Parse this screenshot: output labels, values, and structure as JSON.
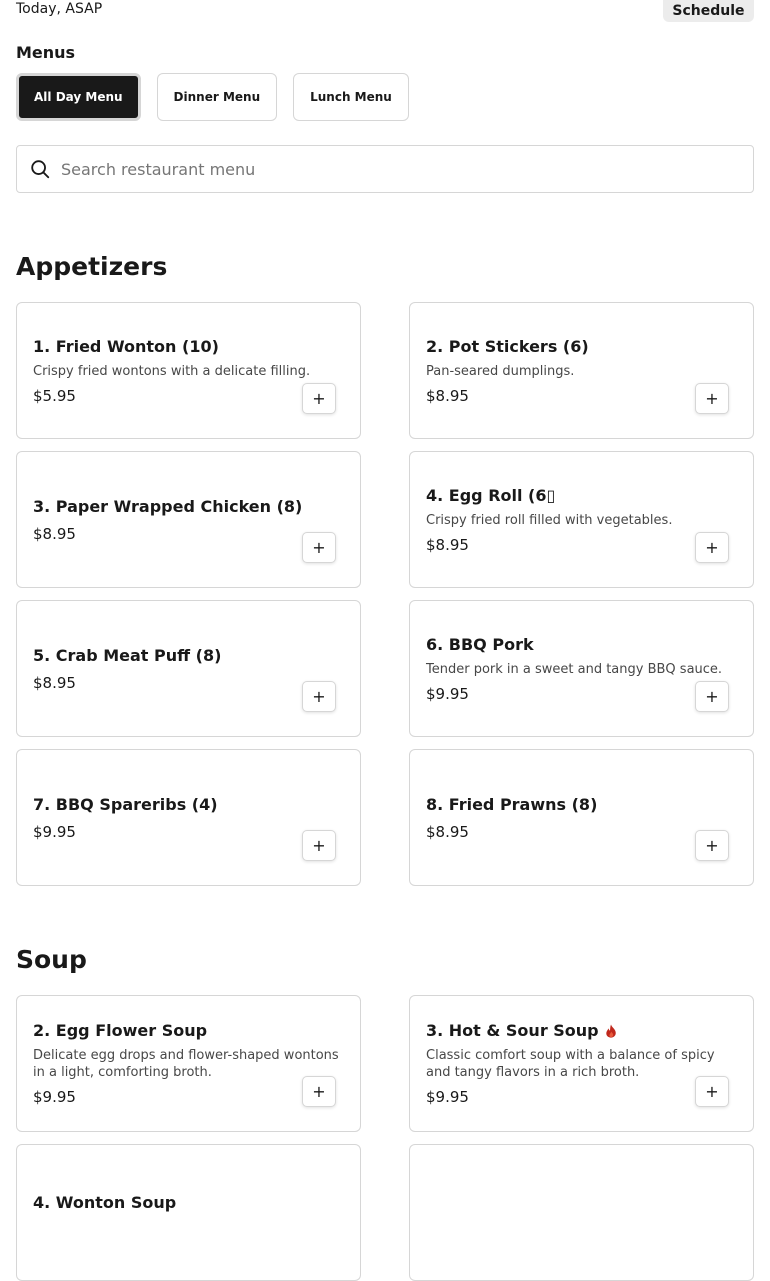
{
  "header": {
    "time_label": "Today, ASAP",
    "schedule_label": "Schedule"
  },
  "menus": {
    "heading": "Menus",
    "tabs": [
      {
        "label": "All Day Menu",
        "active": true
      },
      {
        "label": "Dinner Menu",
        "active": false
      },
      {
        "label": "Lunch Menu",
        "active": false
      }
    ]
  },
  "search": {
    "icon": "search-icon",
    "placeholder": "Search restaurant menu"
  },
  "add_icon": "+",
  "colors": {
    "spicy": "#c0281c"
  },
  "sections": [
    {
      "title": "Appetizers",
      "items": [
        {
          "name": "1. Fried Wonton (10)",
          "description": "Crispy fried wontons with a delicate filling.",
          "price": "$5.95"
        },
        {
          "name": "2. Pot Stickers (6)",
          "description": "Pan-seared dumplings.",
          "price": "$8.95"
        },
        {
          "name": "3. Paper Wrapped Chicken (8)",
          "description": "",
          "price": "$8.95"
        },
        {
          "name": "4. Egg Roll (6▯",
          "description": "Crispy fried roll filled with vegetables.",
          "price": "$8.95"
        },
        {
          "name": "5. Crab Meat Puff (8)",
          "description": "",
          "price": "$8.95"
        },
        {
          "name": "6. BBQ Pork",
          "description": "Tender pork in a sweet and tangy BBQ sauce.",
          "price": "$9.95"
        },
        {
          "name": "7. BBQ Spareribs (4)",
          "description": "",
          "price": "$9.95"
        },
        {
          "name": "8. Fried Prawns (8)",
          "description": "",
          "price": "$8.95"
        }
      ]
    },
    {
      "title": "Soup",
      "items": [
        {
          "name": "2. Egg Flower Soup",
          "description": "Delicate egg drops and flower-shaped wontons in a light, comforting broth.",
          "price": "$9.95"
        },
        {
          "name": "3. Hot & Sour Soup",
          "description": "Classic comfort soup with a balance of spicy and tangy flavors in a rich broth.",
          "price": "$9.95",
          "spicy": true
        },
        {
          "name": "4. Wonton Soup",
          "description": "",
          "price": ""
        },
        {
          "name": "",
          "description": "",
          "price": ""
        }
      ]
    }
  ]
}
